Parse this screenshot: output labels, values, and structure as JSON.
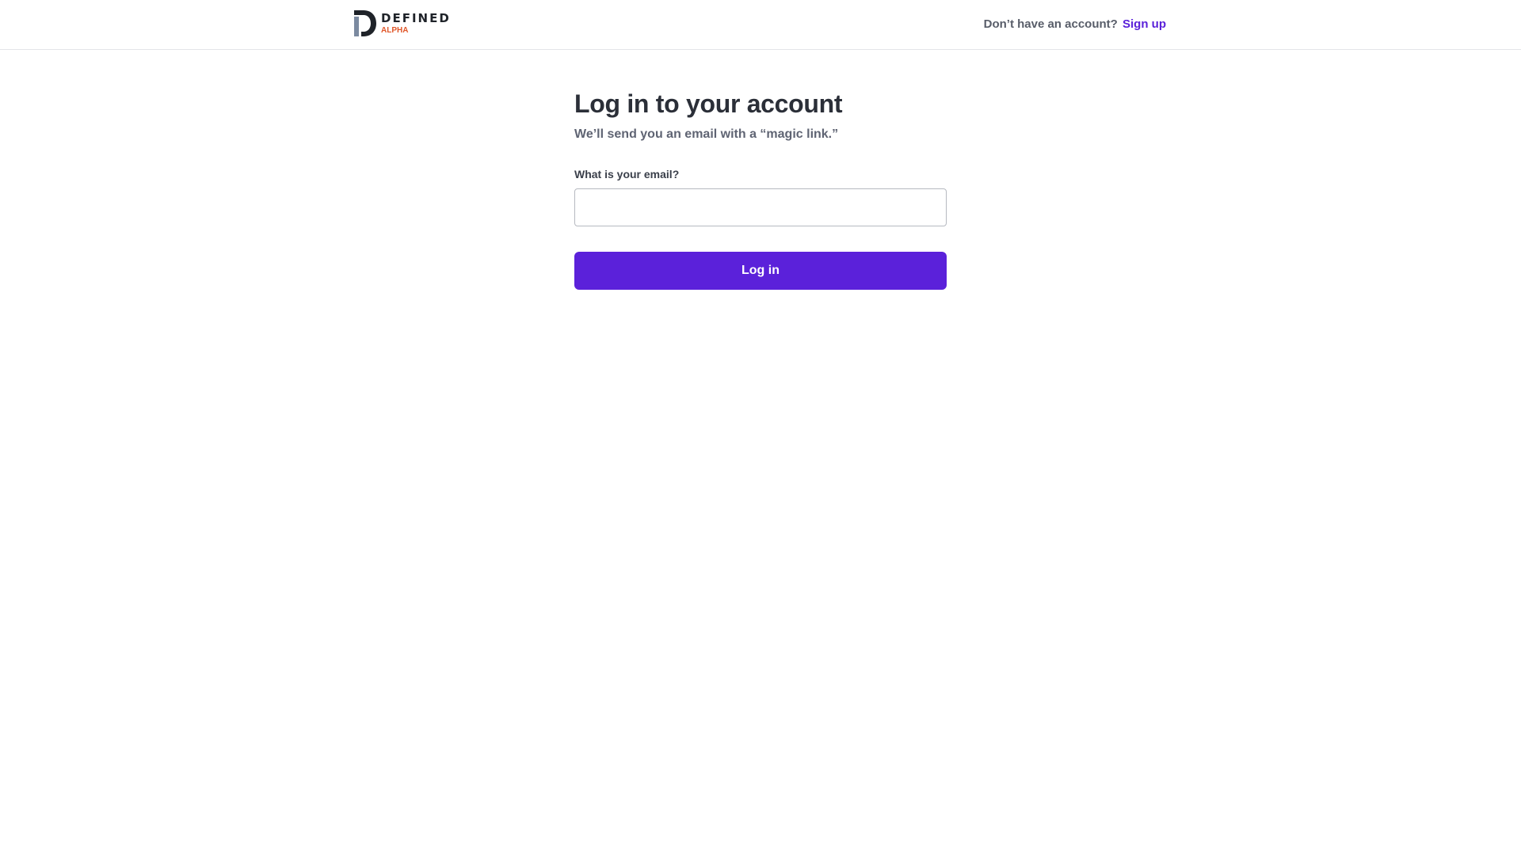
{
  "header": {
    "logo": {
      "wordmark": "DEFINED",
      "badge": "ALPHA",
      "icon": "defined-logo-icon",
      "badge_color": "#e0572a"
    },
    "signup_prompt": "Don’t have an account?",
    "signup_link": "Sign up"
  },
  "login": {
    "title": "Log in to your account",
    "subtitle": "We’ll send you an email with a “magic link.”",
    "email_label": "What is your email?",
    "email_value": "",
    "email_placeholder": "",
    "submit_label": "Log in"
  },
  "colors": {
    "accent": "#5b21da",
    "text_primary": "#2b2f38",
    "text_secondary": "#5f6473",
    "border": "#b6b9c0"
  }
}
